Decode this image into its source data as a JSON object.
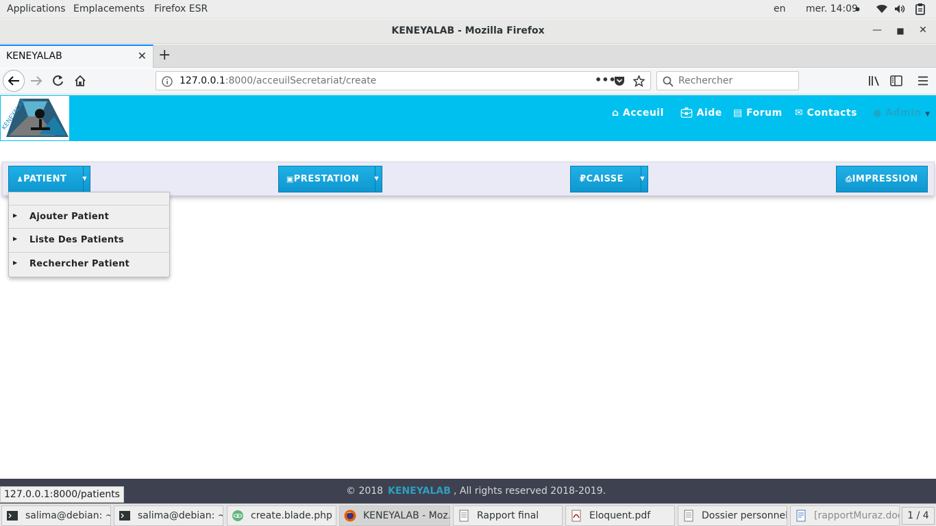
{
  "system_bar": {
    "menu": [
      "Applications",
      "Emplacements",
      "Firefox ESR"
    ],
    "lang": "en",
    "clock": "mer. 14:09"
  },
  "window": {
    "title": "KENEYALAB - Mozilla Firefox"
  },
  "browser": {
    "tab_title": "KENEYALAB",
    "url_host": "127.0.0.1",
    "url_rest": ":8000/acceuilSecretariat/create",
    "search_placeholder": "Rechercher"
  },
  "site": {
    "logo_text": "KENEYALAB",
    "nav": [
      {
        "label": "Acceuil",
        "icon": "home-icon"
      },
      {
        "label": "Aide",
        "icon": "briefcase-icon"
      },
      {
        "label": "Forum",
        "icon": "list-icon"
      },
      {
        "label": "Contacts",
        "icon": "envelope-icon"
      },
      {
        "label": "Admin",
        "icon": "user-icon"
      }
    ]
  },
  "toolbar": {
    "buttons": [
      {
        "label": "PATIENT",
        "icon": "user-icon"
      },
      {
        "label": "PRESTATION",
        "icon": "medkit-icon"
      },
      {
        "label": "CAISSE",
        "icon": "ruble-icon"
      },
      {
        "label": "IMPRESSION",
        "icon": "print-icon"
      }
    ]
  },
  "patient_menu": {
    "items": [
      "Ajouter Patient",
      "Liste Des Patients",
      "Rechercher Patient"
    ]
  },
  "footer": {
    "copyright": "© 2018",
    "brand": "KENEYALAB",
    "rights": ", All rights reserved 2018-2019."
  },
  "status_link": "127.0.0.1:8000/patients",
  "taskbar": {
    "tasks": [
      {
        "label": "salima@debian: ~/...",
        "icon": "terminal-icon"
      },
      {
        "label": "salima@debian: ~/...",
        "icon": "terminal-icon"
      },
      {
        "label": "create.blade.php —...",
        "icon": "atom-icon"
      },
      {
        "label": "KENEYALAB - Moz...",
        "icon": "firefox-icon"
      },
      {
        "label": "Rapport final",
        "icon": "document-icon"
      },
      {
        "label": "Eloquent.pdf",
        "icon": "pdf-icon"
      },
      {
        "label": "Dossier personnel",
        "icon": "folder-icon"
      },
      {
        "label": "[rapportMuraz.doc...",
        "icon": "writer-icon"
      }
    ],
    "pager": "1 / 4"
  },
  "colors": {
    "header_bg": "#00c0ef",
    "button_blue": "#1aa8dd",
    "footer_bg": "#3e4150",
    "brand_teal": "#2d9fc0"
  }
}
